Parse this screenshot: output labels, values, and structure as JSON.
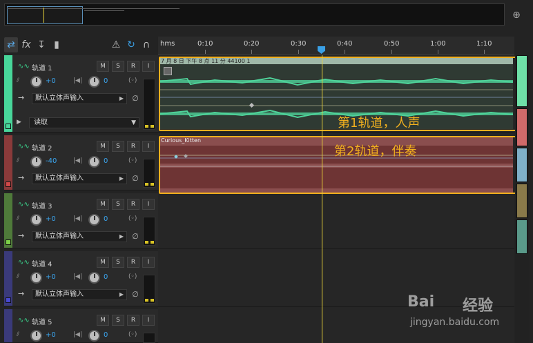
{
  "toolbar": {
    "buttons": [
      "multitrack-icon",
      "fx-icon",
      "send-icon",
      "eq-icon"
    ],
    "right_icons": [
      "metronome-icon",
      "loop-icon",
      "headphone-icon"
    ]
  },
  "ruler": {
    "labels": [
      "hms",
      "0:10",
      "0:20",
      "0:30",
      "0:40",
      "0:50",
      "1:00",
      "1:10"
    ]
  },
  "tracks": [
    {
      "name": "轨道 1",
      "volume": "+0",
      "pan": "0",
      "input": "默认立体声输入",
      "mode": "读取",
      "color": "#48d69a",
      "m": "M",
      "s": "S",
      "r": "R",
      "i": "I"
    },
    {
      "name": "轨道 2",
      "volume": "-40",
      "pan": "0",
      "input": "默认立体声输入",
      "color": "#d04848",
      "m": "M",
      "s": "S",
      "r": "R",
      "i": "I"
    },
    {
      "name": "轨道 3",
      "volume": "+0",
      "pan": "0",
      "input": "默认立体声输入",
      "color": "#7cd048",
      "m": "M",
      "s": "S",
      "r": "R",
      "i": "I"
    },
    {
      "name": "轨道 4",
      "volume": "+0",
      "pan": "0",
      "input": "默认立体声输入",
      "color": "#4848d0",
      "m": "M",
      "s": "S",
      "r": "R",
      "i": "I"
    },
    {
      "name": "轨道 5",
      "volume": "+0",
      "pan": "0",
      "input": "",
      "color": "#4848d0",
      "m": "M",
      "s": "S",
      "r": "R",
      "i": "I"
    }
  ],
  "clips": {
    "clip1_title": "7 月 8 日 下午 8 点 11 分 44100 1",
    "clip2_title": "Curious_Kitten"
  },
  "annotations": {
    "a1": "第1轨道，人声",
    "a2": "第2轨道，伴奏"
  },
  "watermark": {
    "brand": "Bai",
    "brand2": "经验",
    "url": "jingyan.baidu.com"
  }
}
